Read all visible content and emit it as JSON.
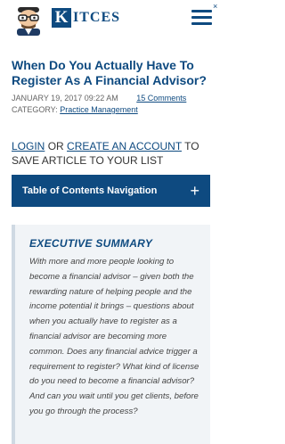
{
  "header": {
    "logo_initial": "K",
    "logo_rest": "ITCES",
    "close_glyph": "×",
    "avatar_icon": "cartoon-avatar-icon",
    "menu_icon": "hamburger-menu-icon"
  },
  "article": {
    "title": "When Do You Actually Have To Register As A Financial Advisor?",
    "date": "JANUARY 19, 2017 09:22 AM",
    "comments": "15 Comments",
    "category_label": "CATEGORY:",
    "category": "Practice Management"
  },
  "account": {
    "login": "LOGIN",
    "or": "OR",
    "create": "CREATE AN ACCOUNT",
    "suffix": "TO SAVE ARTICLE TO YOUR LIST"
  },
  "toc": {
    "label": "Table of Contents Navigation",
    "toggle": "+"
  },
  "summary": {
    "title": "EXECUTIVE SUMMARY",
    "body": "With more and more people looking to become a financial advisor – given both the rewarding nature of helping people and the income potential it brings – questions about when you actually have to register as a financial advisor are becoming more common. Does any financial advice trigger a requirement to register? What kind of license do you need to become a financial advisor? And can you wait until you get clients, before you go through the process?"
  },
  "colors": {
    "brand": "#0e4a80",
    "summary_bg": "#f1f4f7"
  }
}
